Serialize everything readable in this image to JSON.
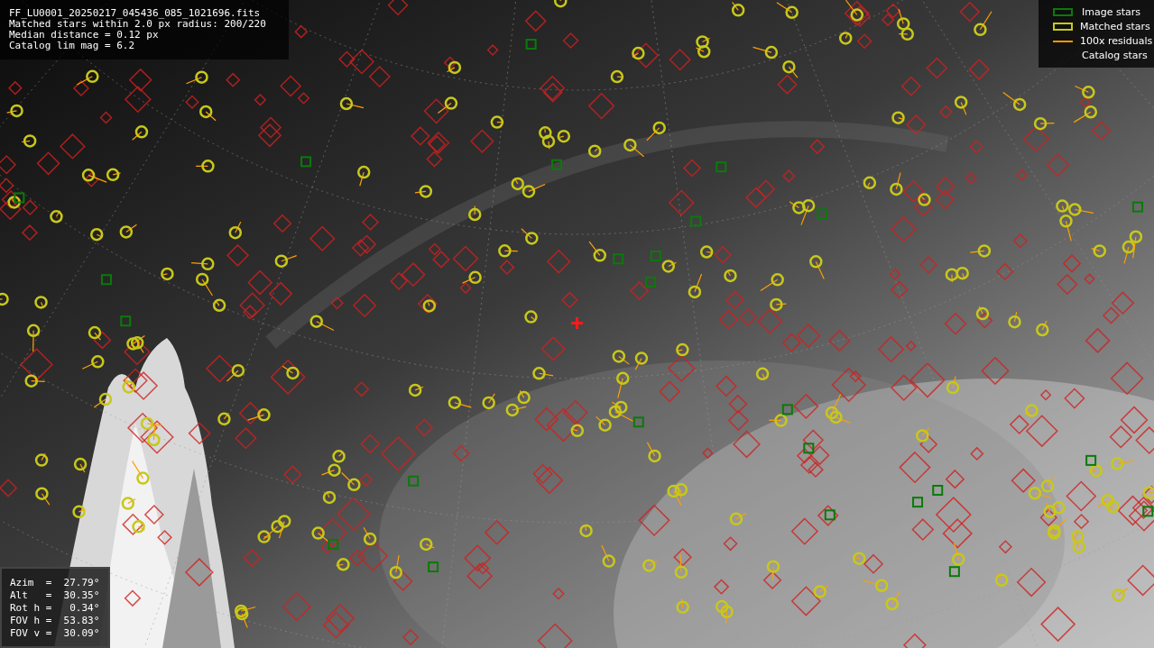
{
  "info": [
    "FF_LU0001_20250217_045436_085_1021696.fits",
    "Matched stars within 2.0 px radius: 200/220",
    "Median distance = 0.12 px",
    "Catalog lim mag = 6.2"
  ],
  "legend": [
    {
      "label": "Image stars"
    },
    {
      "kind": "matched",
      "label": "Matched stars"
    },
    {
      "kind": "residual",
      "label": "100x residuals"
    },
    {
      "kind": "catalog",
      "label": "Catalog stars"
    }
  ],
  "pointing": [
    "Azim  =  27.79°",
    "Alt   =  30.35°",
    "Rot h =   0.34°",
    "FOV h =  53.83°",
    "FOV v =  30.09°"
  ]
}
